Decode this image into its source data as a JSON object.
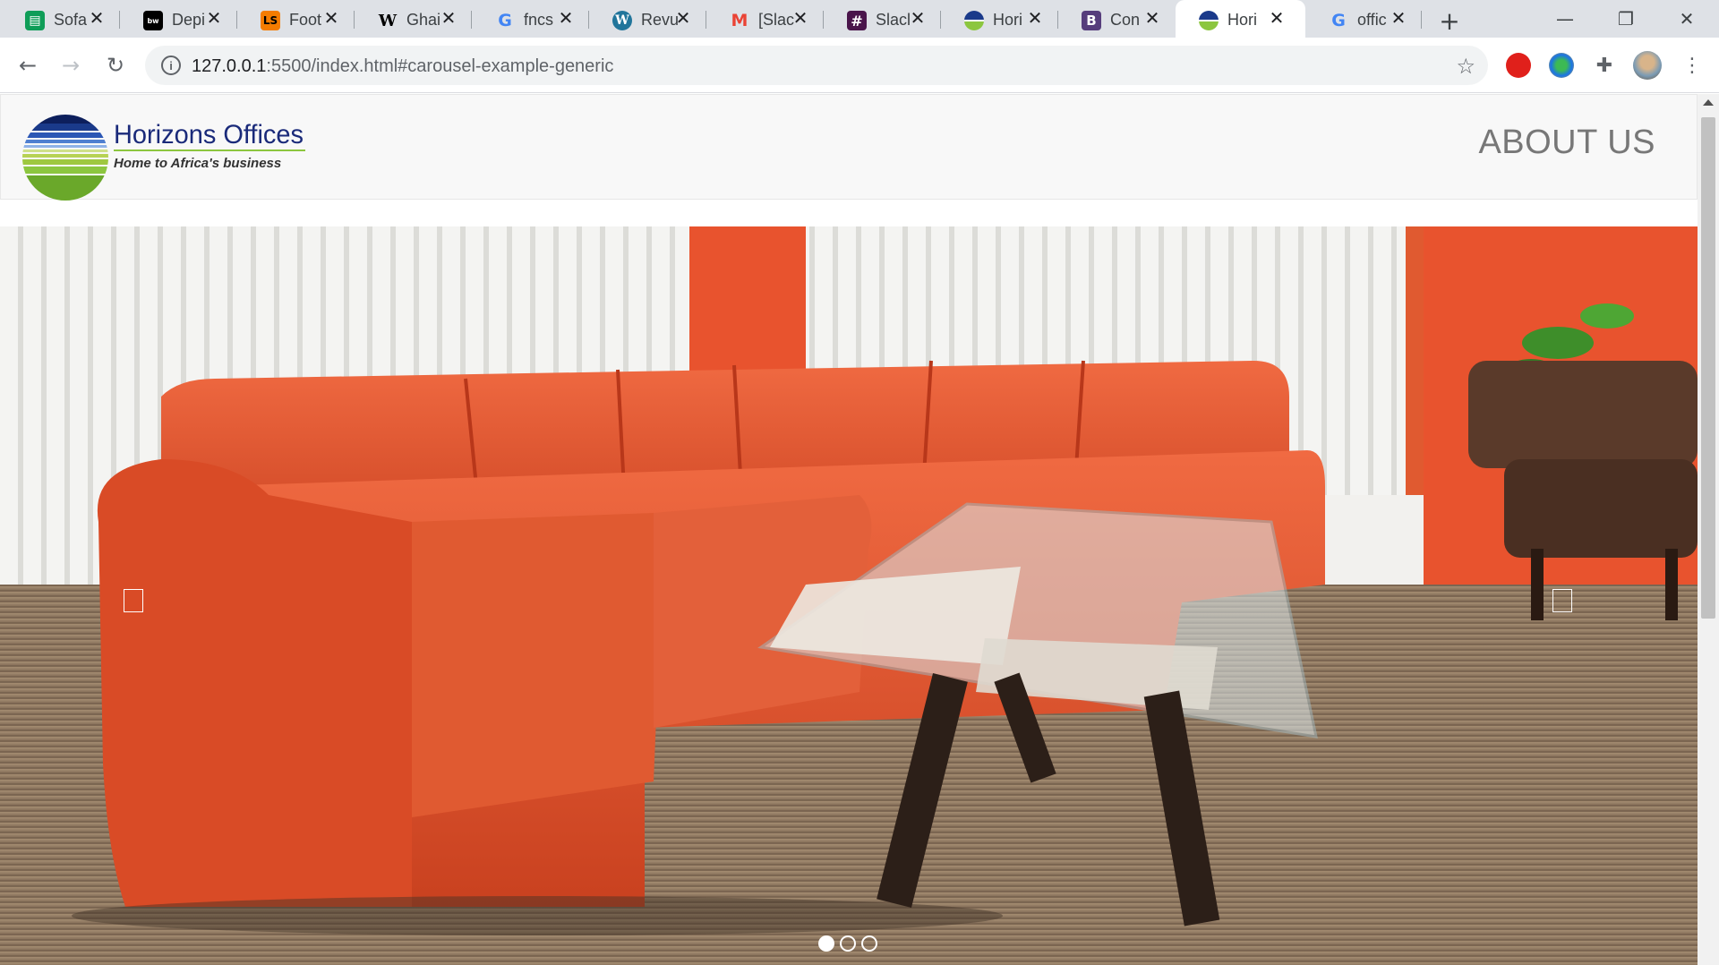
{
  "browser": {
    "tabs": [
      {
        "title": "Sofa",
        "icon": "sheets-icon",
        "color": "#0f9d58"
      },
      {
        "title": "Depi",
        "icon": "betway-icon",
        "color": "#000000"
      },
      {
        "title": "Foot",
        "icon": "livescore-icon",
        "color": "#f57c00"
      },
      {
        "title": "Ghai",
        "icon": "wikipedia-icon",
        "color": "#ffffff"
      },
      {
        "title": "fncs",
        "icon": "google-icon",
        "color": "#ffffff"
      },
      {
        "title": "Revu",
        "icon": "wordpress-icon",
        "color": "#21759b"
      },
      {
        "title": "[Slac",
        "icon": "gmail-icon",
        "color": "#ffffff"
      },
      {
        "title": "Slacl",
        "icon": "slack-icon",
        "color": "#4a154b"
      },
      {
        "title": "Hori",
        "icon": "horizons-icon",
        "color": "#ffffff"
      },
      {
        "title": "Con",
        "icon": "bootstrap-icon",
        "color": "#563d7c"
      },
      {
        "title": "Hori",
        "icon": "horizons-icon",
        "color": "#ffffff",
        "active": true
      },
      {
        "title": "offic",
        "icon": "google-icon",
        "color": "#ffffff"
      }
    ],
    "url_host": "127.0.0.1",
    "url_rest": ":5500/index.html#carousel-example-generic"
  },
  "site": {
    "logo_title": "Horizons Offices",
    "logo_tagline": "Home to Africa's business",
    "nav_about": "ABOUT US"
  },
  "carousel": {
    "slide_count": 3,
    "active_index": 0,
    "slide_subject": "orange sectional sofa with glass coffee table"
  },
  "colors": {
    "accent_orange": "#e8502e",
    "logo_blue": "#1a3a8a",
    "logo_green": "#8cc63f"
  }
}
